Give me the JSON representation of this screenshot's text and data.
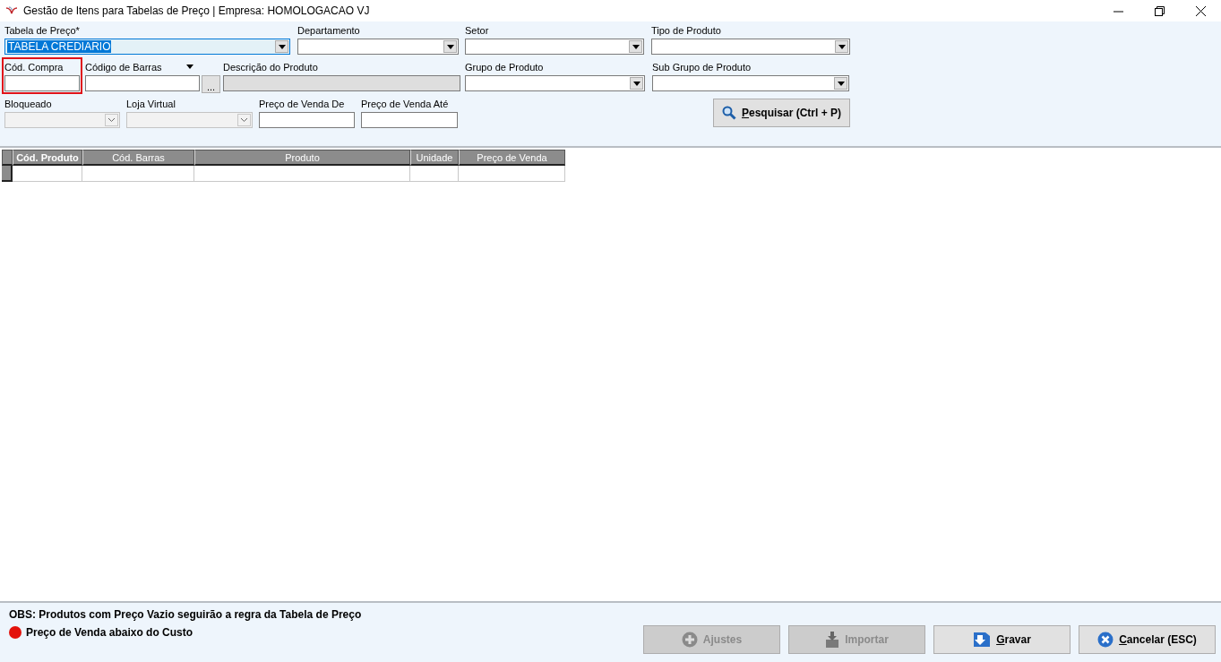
{
  "window": {
    "title": "Gestão de Itens para Tabelas de Preço | Empresa: HOMOLOGACAO VJ"
  },
  "filter_rows": [
    [
      {
        "label": "Tabela de Preço*",
        "kind": "combo",
        "value": "TABELA CREDIARIO",
        "focused": true,
        "highlighted": false
      },
      {
        "label": "Departamento",
        "kind": "combo",
        "focused": false,
        "highlighted": false
      },
      {
        "label": "Setor",
        "kind": "combo",
        "focused": false,
        "highlighted": false
      },
      {
        "label": "Tipo de Produto",
        "kind": "combo",
        "focused": false,
        "highlighted": false
      }
    ],
    [
      {
        "label": "Cód. Compra",
        "kind": "text",
        "focused": false,
        "highlighted": true
      },
      {
        "label": "Código de Barras",
        "kind": "lookup",
        "button_text": "...",
        "focused": false,
        "highlighted": false
      },
      {
        "label": "Descrição do Produto",
        "kind": "readonly",
        "focused": false,
        "highlighted": false
      },
      {
        "label": "Grupo de Produto",
        "kind": "combo",
        "focused": false,
        "highlighted": false
      },
      {
        "label": "Sub Grupo de Produto",
        "kind": "combo",
        "focused": false,
        "highlighted": false
      }
    ],
    [
      {
        "label": "Bloqueado",
        "kind": "select",
        "focused": false,
        "highlighted": false
      },
      {
        "label": "Loja Virtual",
        "kind": "select",
        "focused": false,
        "highlighted": false
      },
      {
        "label": "Preço de Venda De",
        "kind": "text",
        "focused": false,
        "highlighted": false
      },
      {
        "label": "Preço de Venda Até",
        "kind": "text",
        "focused": false,
        "highlighted": false
      }
    ]
  ],
  "search_button": {
    "label": "Pesquisar (Ctrl + P)",
    "mnemonic": true
  },
  "table": {
    "columns": [
      {
        "label": "Cód. Produto",
        "bold": true
      },
      {
        "label": "Cód. Barras",
        "bold": false
      },
      {
        "label": "Produto",
        "bold": false
      },
      {
        "label": "Unidade",
        "bold": false
      },
      {
        "label": "Preço de Venda",
        "bold": false
      }
    ]
  },
  "footer": {
    "note": "OBS: Produtos com Preço Vazio seguirão a regra da Tabela de Preço",
    "legend": [
      {
        "label": "Preço de Venda abaixo do Custo",
        "color": "#e3120b"
      }
    ],
    "buttons": [
      {
        "label": "Ajustes",
        "kind": "plus",
        "disabled": true,
        "mnemonic": false
      },
      {
        "label": "Importar",
        "kind": "import",
        "disabled": true,
        "mnemonic": false
      },
      {
        "label": "Gravar",
        "kind": "save",
        "disabled": false,
        "mnemonic": true
      },
      {
        "label": "Cancelar (ESC)",
        "kind": "cancel",
        "disabled": false,
        "mnemonic": true
      }
    ]
  }
}
